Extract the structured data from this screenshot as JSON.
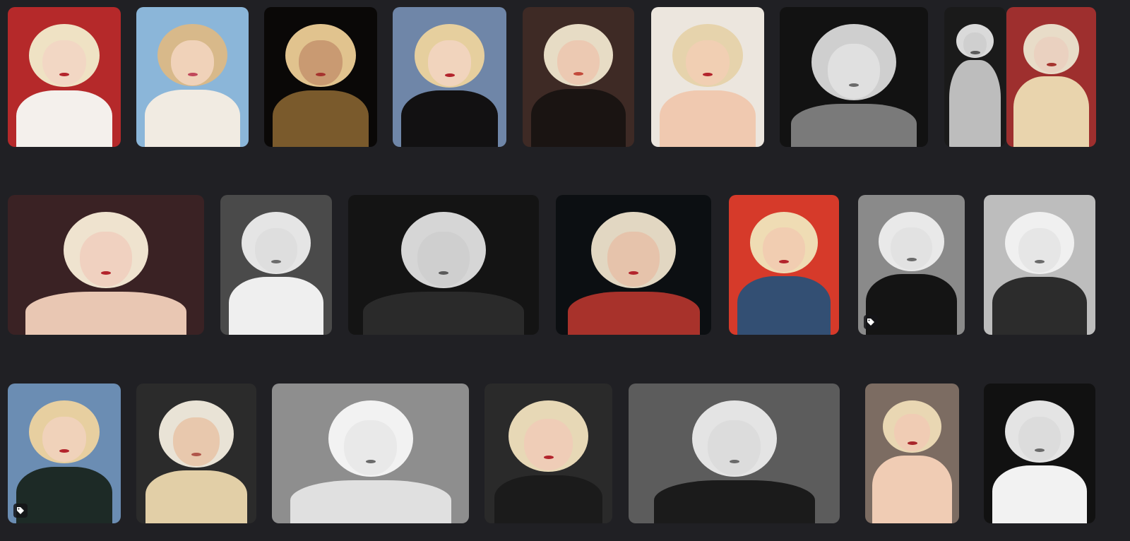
{
  "gallery": {
    "rows": [
      {
        "tiles": [
          {
            "name": "photo-1",
            "bg": "#b5292a",
            "hair": "#efe2c4",
            "skin": "#f2d7c4",
            "body": "#f4f0ec",
            "lips": "#b3242c"
          },
          {
            "name": "photo-2",
            "bg": "#8bb6d9",
            "hair": "#d8b98a",
            "skin": "#f0d2b9",
            "body": "#f1ebe2",
            "lips": "#c0475a"
          },
          {
            "name": "photo-3",
            "bg": "#0a0807",
            "hair": "#e1c38e",
            "skin": "#c99a72",
            "body": "#7a5a2c",
            "lips": "#a5332e"
          },
          {
            "name": "photo-4",
            "bg": "#6f86a8",
            "hair": "#e6cf9e",
            "skin": "#f1d4bd",
            "body": "#121112",
            "lips": "#b3242c"
          },
          {
            "name": "photo-5",
            "bg": "#3e2a25",
            "hair": "#e7dcc5",
            "skin": "#ecc9b2",
            "body": "#1a1412",
            "lips": "#c34a3b"
          },
          {
            "name": "photo-6",
            "bg": "#ece6de",
            "hair": "#e6d3ac",
            "skin": "#f1cfb3",
            "body": "#f0c9b0",
            "lips": "#b3242c"
          },
          {
            "name": "photo-7",
            "bg": "#121212",
            "hair": "#cfcfcf",
            "skin": "#e0e0e0",
            "body": "#7a7a7a",
            "lips": "#6a6a6a"
          },
          {
            "name": "photo-8",
            "bg": "#1a1a1a",
            "hair": "#dadada",
            "skin": "#cfcfcf",
            "body": "#bdbdbd",
            "lips": "#5a5a5a"
          },
          {
            "name": "photo-9",
            "bg": "#9e2f2e",
            "hair": "#e8dcc8",
            "skin": "#ead1c0",
            "body": "#e9d4ad",
            "lips": "#a5332e"
          }
        ]
      },
      {
        "tiles": [
          {
            "name": "photo-10",
            "bg": "#3a2224",
            "hair": "#efe3cf",
            "skin": "#f0d1c0",
            "body": "#e9c7b3",
            "lips": "#b3242c"
          },
          {
            "name": "photo-11",
            "bg": "#4a4a4a",
            "hair": "#e5e5e5",
            "skin": "#dedede",
            "body": "#efefef",
            "lips": "#6a6a6a"
          },
          {
            "name": "photo-12",
            "bg": "#141414",
            "hair": "#d6d6d6",
            "skin": "#cfcfcf",
            "body": "#2a2a2a",
            "lips": "#5a5a5a"
          },
          {
            "name": "photo-13",
            "bg": "#0c0f12",
            "hair": "#e2d7c2",
            "skin": "#e6c3ab",
            "body": "#a8322b",
            "lips": "#b3242c"
          },
          {
            "name": "photo-14",
            "bg": "#d63a2a",
            "hair": "#efdcb4",
            "skin": "#f1cdb1",
            "body": "#334f73",
            "lips": "#b3242c"
          },
          {
            "name": "photo-15",
            "bg": "#8a8a8a",
            "hair": "#e9e9e9",
            "skin": "#e2e2e2",
            "body": "#141414",
            "lips": "#6a6a6a",
            "badge": true
          },
          {
            "name": "photo-16",
            "bg": "#bdbdbd",
            "hair": "#f0f0f0",
            "skin": "#e6e6e6",
            "body": "#2c2c2c",
            "lips": "#6a6a6a"
          }
        ]
      },
      {
        "tiles": [
          {
            "name": "photo-17",
            "bg": "#6b8db3",
            "hair": "#e7cfa0",
            "skin": "#f0d2ba",
            "body": "#1d2a26",
            "lips": "#b3242c",
            "badge": true
          },
          {
            "name": "photo-18",
            "bg": "#2b2b2b",
            "hair": "#e9e3d6",
            "skin": "#e8c8ad",
            "body": "#e2cfa7",
            "lips": "#b0554a"
          },
          {
            "name": "photo-19",
            "bg": "#8e8e8e",
            "hair": "#f2f2f2",
            "skin": "#e9e9e9",
            "body": "#e0e0e0",
            "lips": "#6a6a6a"
          },
          {
            "name": "photo-20",
            "bg": "#2a2a2a",
            "hair": "#e7d8b6",
            "skin": "#efcdb7",
            "body": "#1b1b1b",
            "lips": "#b3242c"
          },
          {
            "name": "photo-21",
            "bg": "#5c5c5c",
            "hair": "#e4e4e4",
            "skin": "#dcdcdc",
            "body": "#1b1b1b",
            "lips": "#6a6a6a"
          },
          {
            "name": "photo-22",
            "bg": "#7c6c62",
            "hair": "#e9d7b3",
            "skin": "#f0ccb4",
            "body": "#f0ccb4",
            "lips": "#a8262b"
          },
          {
            "name": "photo-23",
            "bg": "#111111",
            "hair": "#e4e4e4",
            "skin": "#dcdcdc",
            "body": "#f2f2f2",
            "lips": "#6a6a6a"
          }
        ]
      }
    ]
  }
}
